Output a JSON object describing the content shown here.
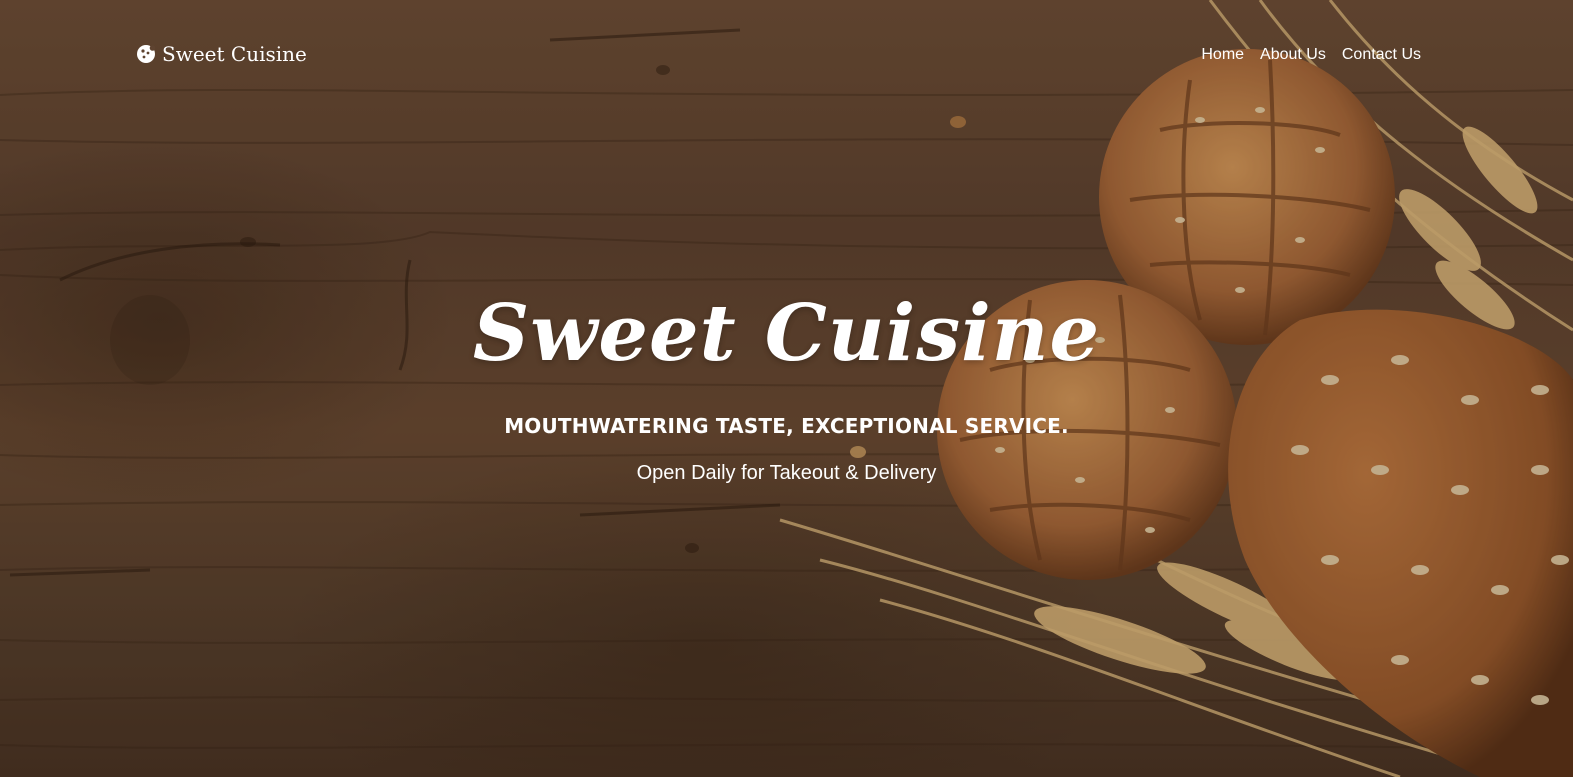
{
  "brand": {
    "name": "Sweet Cuisine",
    "icon": "cookie-icon"
  },
  "nav": {
    "items": [
      {
        "label": "Home"
      },
      {
        "label": "About Us"
      },
      {
        "label": "Contact Us"
      }
    ]
  },
  "hero": {
    "title": "Sweet Cuisine",
    "tagline": "MOUTHWATERING TASTE, EXCEPTIONAL SERVICE.",
    "hours": "Open Daily for Takeout & Delivery",
    "background": "wood-table-bread-photo"
  },
  "colors": {
    "text": "#ffffff",
    "wood": "#5e4330",
    "bread": "#b9773f"
  }
}
